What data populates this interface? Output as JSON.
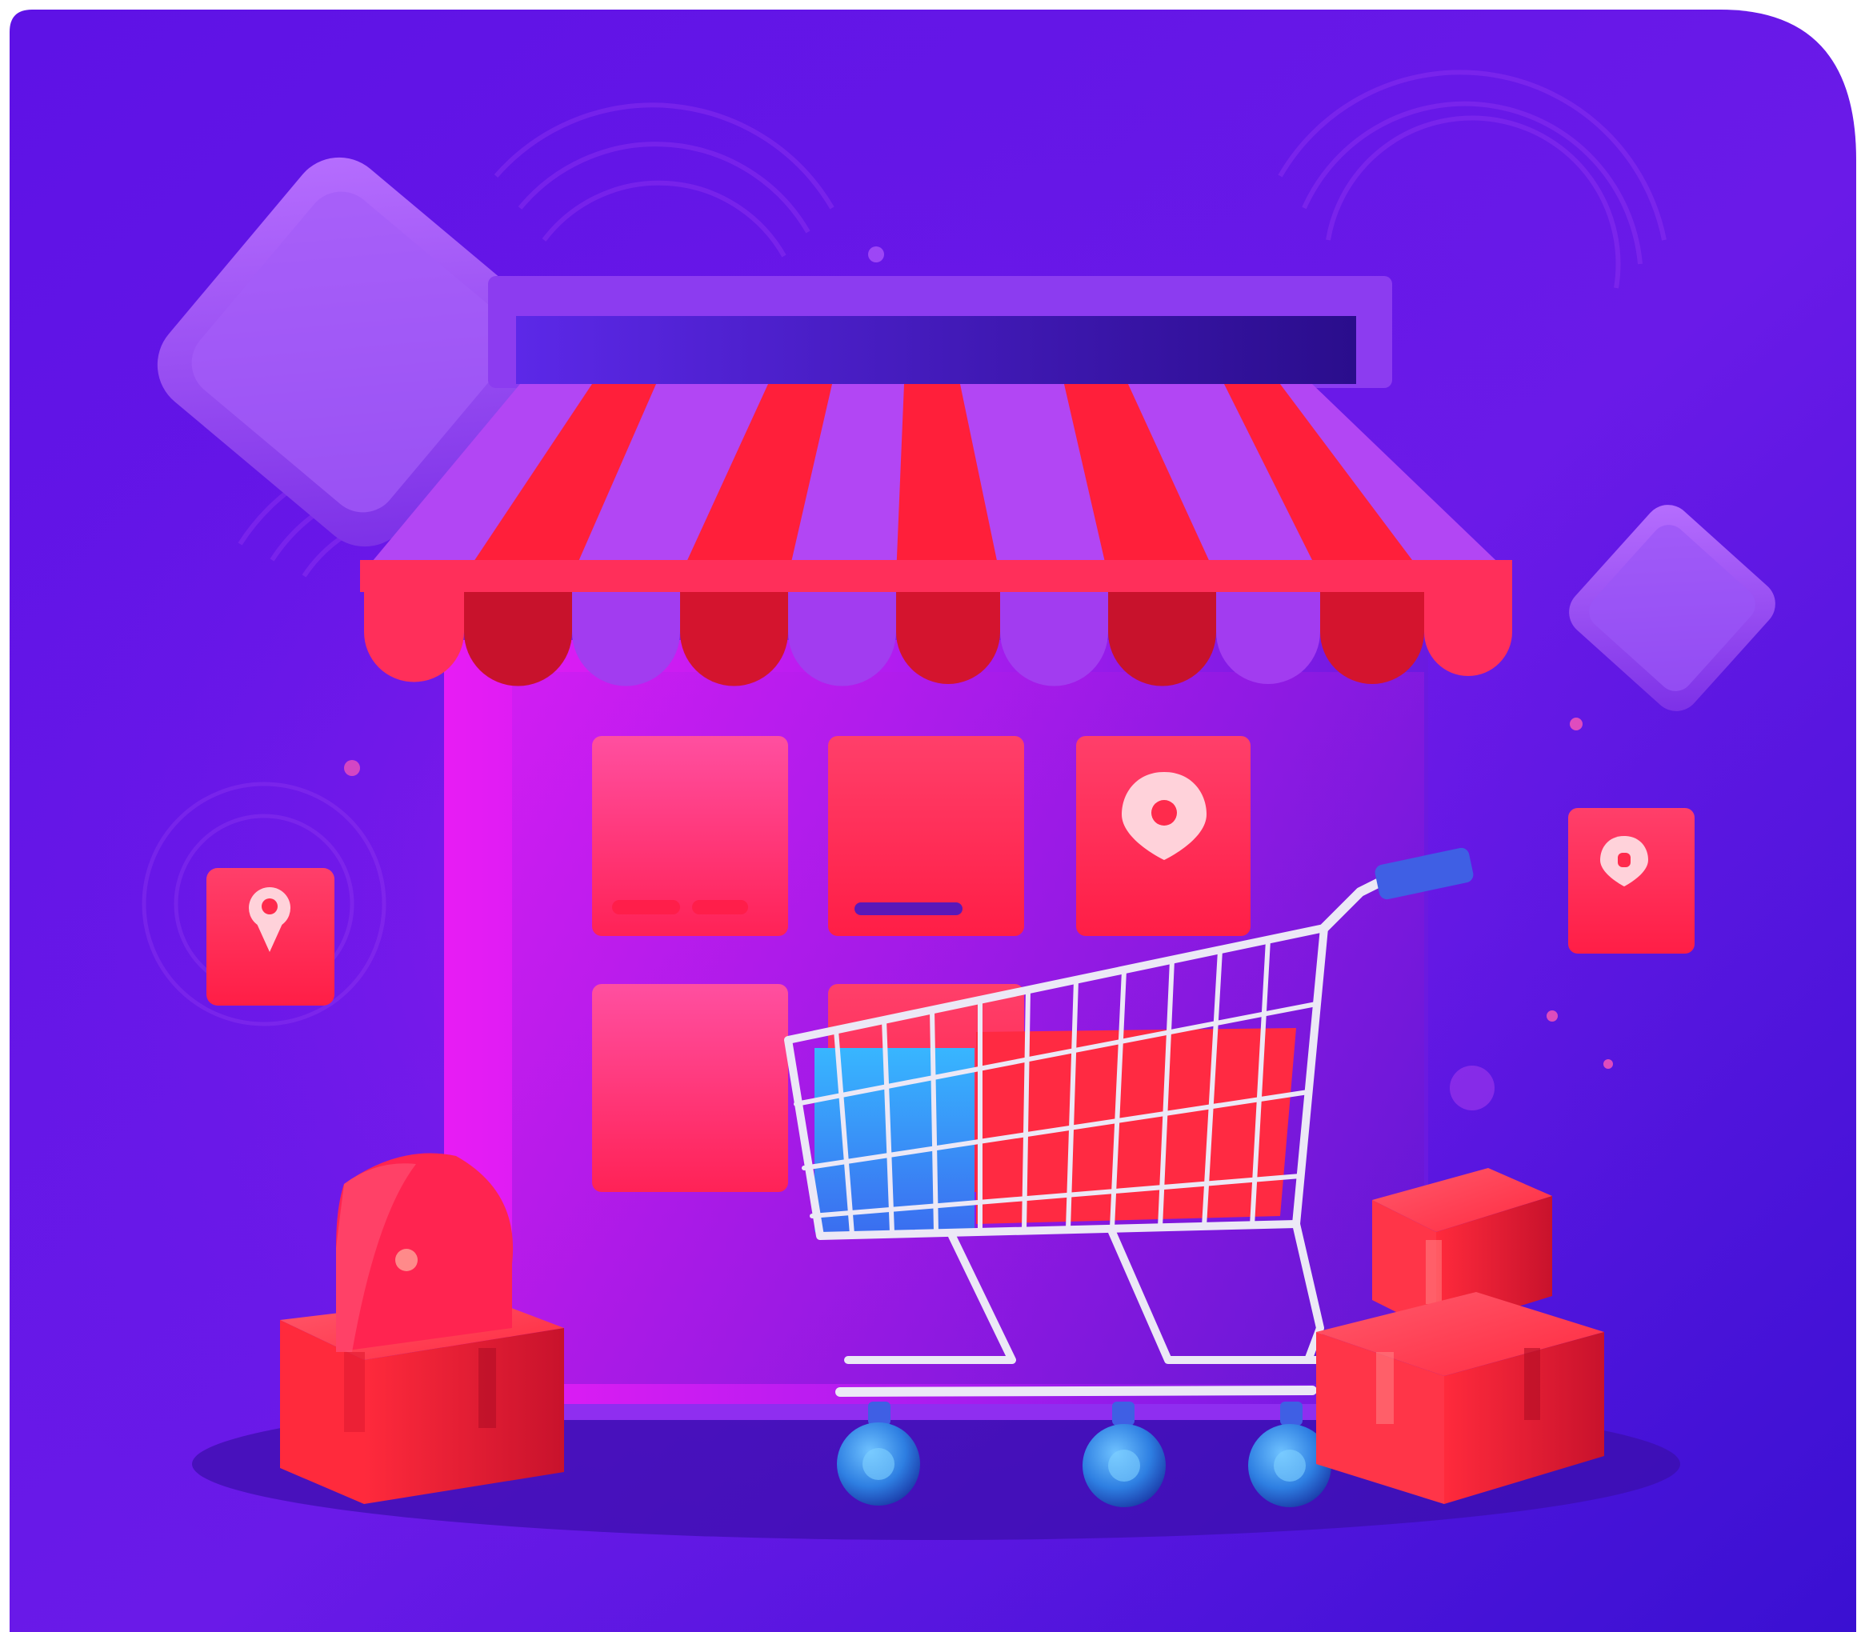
{
  "colors": {
    "background_top": "#5a12e0",
    "background_bottom": "#3a0fd0",
    "accent_magenta": "#e020f0",
    "accent_red": "#ff1e4a",
    "awning_red": "#e0182e",
    "awning_violet": "#a93cf2",
    "cart_silver": "#e9e6f5",
    "wheel_blue": "#2f7fe0",
    "panel_violet": "#8d48f2"
  },
  "icons": [
    "storefront-icon",
    "shopping-cart-icon",
    "location-pin-icon",
    "parcel-box-icon",
    "shopping-bag-icon",
    "signal-waves-icon"
  ]
}
